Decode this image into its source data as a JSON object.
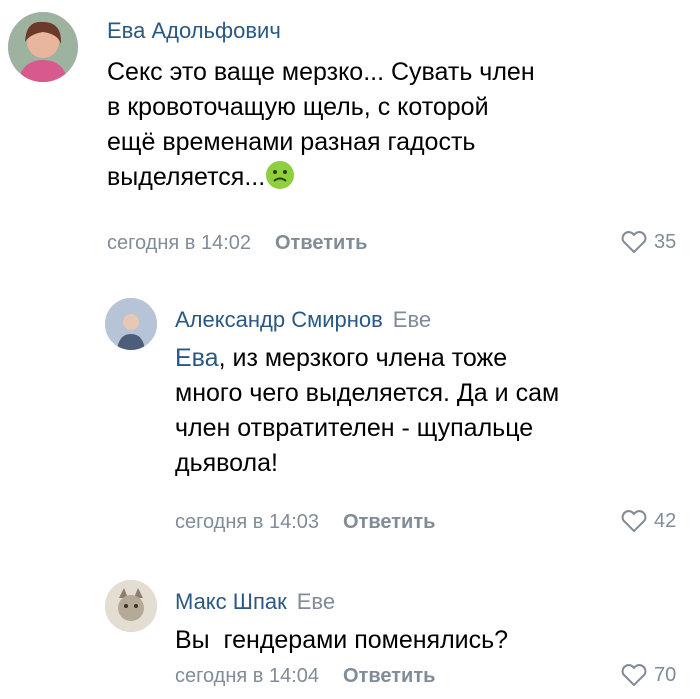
{
  "comments": [
    {
      "author": "Ева Адольфович",
      "reply_to": "",
      "lines": [
        "Секс это ваще мерзко... Сувать член",
        "в кровоточащую щель, с которой",
        "ещё временами разная гадость",
        "выделяется..."
      ],
      "emoji_icon": "nauseated-face-icon",
      "time": "сегодня в 14:02",
      "reply_label": "Ответить",
      "likes": "35"
    },
    {
      "author": "Александр Смирнов",
      "reply_to": "Еве",
      "mention": "Ева",
      "lines": [
        ", из мерзкого члена тоже",
        "много чего выделяется. Да и сам",
        "член отвратителен - щупальце",
        "дьявола!"
      ],
      "time": "сегодня в 14:03",
      "reply_label": "Ответить",
      "likes": "42"
    },
    {
      "author": "Макс Шпак",
      "reply_to": "Еве",
      "lines": [
        "Вы  гендерами поменялись?"
      ],
      "time": "сегодня в 14:04",
      "reply_label": "Ответить",
      "likes": "70"
    }
  ],
  "colors": {
    "author": "#2a5885",
    "meta": "#818c99",
    "text": "#000000"
  }
}
